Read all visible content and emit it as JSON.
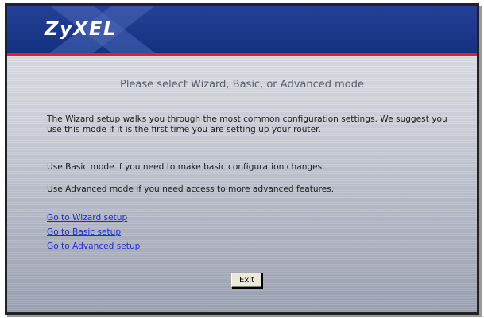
{
  "header": {
    "logo_text": "ZyXEL",
    "brand_color": "#1a3a8f",
    "accent_color": "#e0202a"
  },
  "main": {
    "title": "Please select Wizard, Basic, or Advanced mode",
    "paragraphs": [
      "The Wizard setup walks you through the most common configuration settings. We suggest you use this mode if it is the first time you are setting up your router.",
      "Use Basic mode if you need to make basic configuration changes.",
      "Use Advanced mode if you need access to more advanced features."
    ],
    "links": [
      "Go to Wizard setup",
      "Go to Basic setup",
      "Go to Advanced setup"
    ],
    "exit_label": "Exit"
  }
}
